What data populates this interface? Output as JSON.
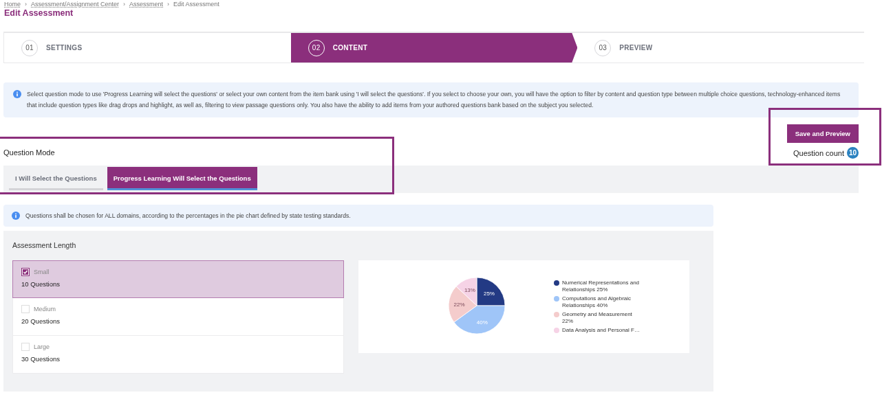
{
  "breadcrumb": {
    "separator": "›",
    "items": [
      {
        "label": "Home"
      },
      {
        "label": "Assessment/Assignment Center"
      },
      {
        "label": "Assessment"
      },
      {
        "label": "Edit Assessment"
      }
    ]
  },
  "page_title": "Edit Assessment",
  "steps": [
    {
      "number": "01",
      "label": "SETTINGS",
      "selected": false
    },
    {
      "number": "02",
      "label": "CONTENT",
      "selected": true
    },
    {
      "number": "03",
      "label": "PREVIEW",
      "selected": false
    }
  ],
  "info_text": "Select question mode to use 'Progress Learning will select the questions' or select your own content from the item bank using 'I will select the questions'. If you select to choose your own, you will have the option to filter by content and question type between multiple choice questions, technology-enhanced items that include question types like drag drops and highlight, as well as, filtering to view passage questions only. You also have the ability to add items from your authored questions bank based on the subject you selected.",
  "save_button": "Save and Preview",
  "question_count": {
    "label": "Question count",
    "value": "10"
  },
  "question_mode": {
    "label": "Question Mode",
    "tabs": [
      {
        "label": "I Will Select the Questions",
        "selected": false
      },
      {
        "label": "Progress Learning Will Select the Questions",
        "selected": true
      }
    ]
  },
  "domains_note": "Questions shall be chosen for ALL domains, according to the percentages in the pie chart defined by state testing standards.",
  "assessment_length": {
    "title": "Assessment Length",
    "options": [
      {
        "name": "Small",
        "questions": "10 Questions",
        "selected": true
      },
      {
        "name": "Medium",
        "questions": "20 Questions",
        "selected": false
      },
      {
        "name": "Large",
        "questions": "30 Questions",
        "selected": false
      }
    ]
  },
  "chart": {
    "legend": [
      {
        "color": "#233a84"
      },
      {
        "color": "#9fc5f8"
      },
      {
        "color": "#f4cccc"
      },
      {
        "color": "#f6d3e6"
      }
    ],
    "chart_data": {
      "type": "pie",
      "categories": [
        "Numerical Representations and Relationships 25%",
        "Computations and Algebraic Relationships 40%",
        "Geometry and Measurement 22%",
        "Data Analysis and Personal F…"
      ],
      "values": [
        25,
        40,
        22,
        13
      ],
      "value_labels": [
        "25%",
        "40%",
        "22%",
        "13%"
      ]
    }
  }
}
